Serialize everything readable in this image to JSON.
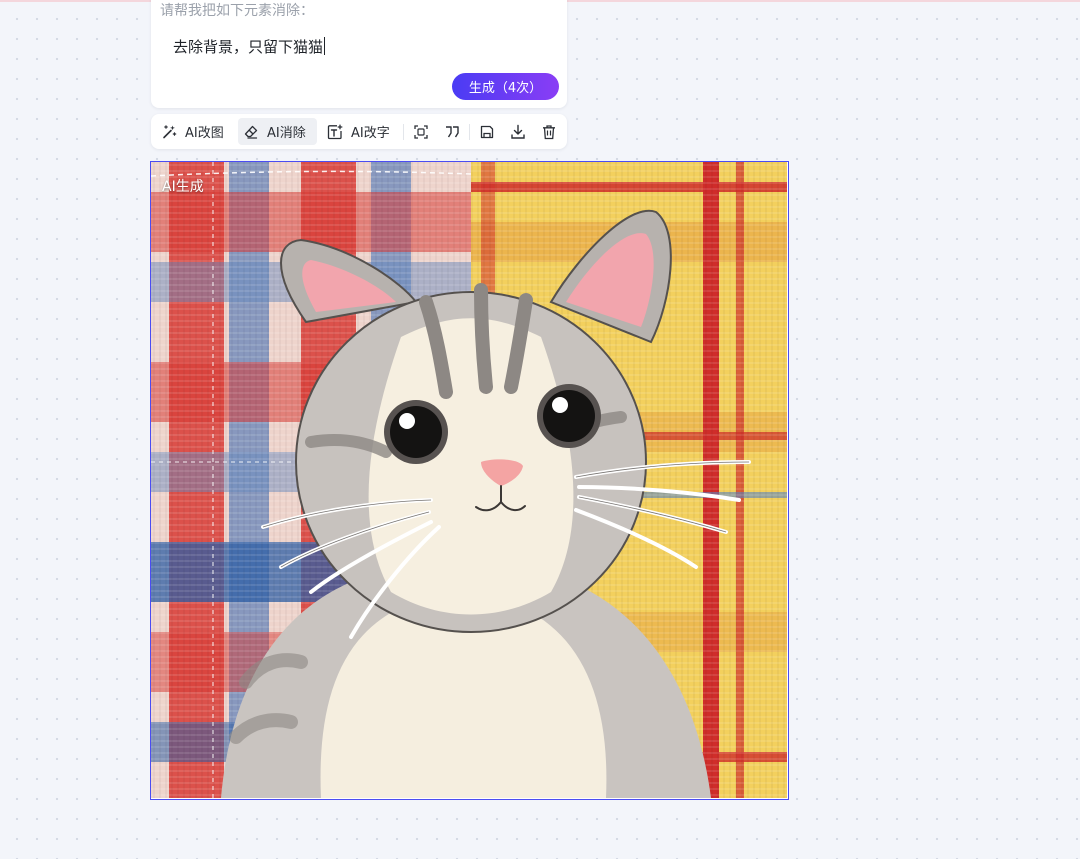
{
  "prompt": {
    "label": "请帮我把如下元素消除：",
    "input_value": "去除背景，只留下猫猫",
    "generate_label": "生成（4次）"
  },
  "toolbar": {
    "items": [
      {
        "label": "AI改图",
        "icon": "magic-wand-icon"
      },
      {
        "label": "AI消除",
        "icon": "eraser-icon",
        "active": true
      },
      {
        "label": "AI改字",
        "icon": "text-edit-icon"
      }
    ],
    "icons": [
      "crop-icon",
      "quote-icon",
      "save-icon",
      "download-icon",
      "delete-icon"
    ]
  },
  "canvas": {
    "badge": "AI生成",
    "image_subject": "cartoon-cat-on-plaid-fabric",
    "selection_color": "#4b4cf2"
  },
  "colors": {
    "accent_start": "#4a3cf4",
    "accent_end": "#8a3df5",
    "background": "#f3f5fa"
  }
}
